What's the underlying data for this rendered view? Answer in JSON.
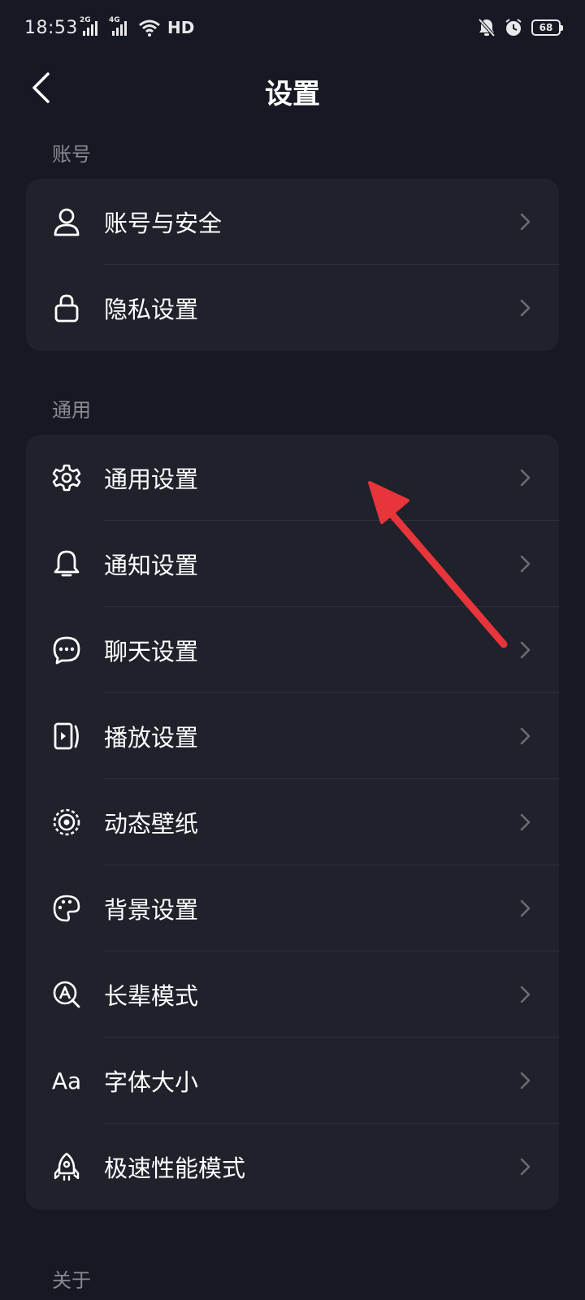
{
  "status_bar": {
    "time": "18:53",
    "network_1": "2G",
    "network_2": "4G",
    "hd_label": "HD",
    "battery": "68",
    "icons": [
      "signal-icon",
      "wifi-icon",
      "bell-off-icon",
      "alarm-icon",
      "battery-icon"
    ]
  },
  "header": {
    "title": "设置",
    "back_icon": "back-arrow-icon"
  },
  "sections": {
    "account": {
      "label": "账号",
      "items": [
        {
          "label": "账号与安全",
          "icon": "person-icon"
        },
        {
          "label": "隐私设置",
          "icon": "lock-icon"
        }
      ]
    },
    "general": {
      "label": "通用",
      "items": [
        {
          "label": "通用设置",
          "icon": "gear-icon"
        },
        {
          "label": "通知设置",
          "icon": "bell-icon"
        },
        {
          "label": "聊天设置",
          "icon": "chat-bubble-icon"
        },
        {
          "label": "播放设置",
          "icon": "play-icon"
        },
        {
          "label": "动态壁纸",
          "icon": "live-wallpaper-icon"
        },
        {
          "label": "背景设置",
          "icon": "palette-icon"
        },
        {
          "label": "长辈模式",
          "icon": "elder-mode-icon"
        },
        {
          "label": "字体大小",
          "icon": "font-size-icon",
          "icon_text": "Aa"
        },
        {
          "label": "极速性能模式",
          "icon": "rocket-icon"
        }
      ]
    },
    "about": {
      "label": "关于"
    }
  },
  "colors": {
    "background": "#161823",
    "card": "#1f212b",
    "divider": "#2e303a",
    "section_label": "#8a8b91",
    "chevron": "#6b6c73",
    "annotation_arrow": "#e8343b"
  }
}
